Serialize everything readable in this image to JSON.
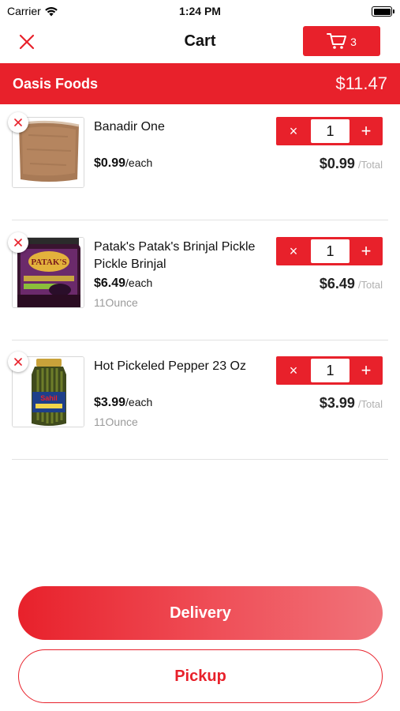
{
  "status_bar": {
    "carrier": "Carrier",
    "time": "1:24 PM",
    "icons": [
      "wifi-icon",
      "battery-icon"
    ]
  },
  "nav": {
    "title": "Cart",
    "close_icon": "close-icon",
    "cart_icon": "cart-icon",
    "cart_count": "3"
  },
  "store": {
    "name": "Oasis Foods",
    "total": "$11.47"
  },
  "items": [
    {
      "name": "Banadir One",
      "price": "$0.99",
      "price_unit": "/each",
      "size": "",
      "quantity": "1",
      "line_total": "$0.99",
      "line_total_label": "/Total"
    },
    {
      "name": "Patak's Patak's Brinjal Pickle Pickle Brinjal",
      "price": "$6.49",
      "price_unit": "/each",
      "size": "11Ounce",
      "quantity": "1",
      "line_total": "$6.49",
      "line_total_label": "/Total",
      "product_label_text": "PATAK'S"
    },
    {
      "name": "Hot Pickeled Pepper 23 Oz",
      "price": "$3.99",
      "price_unit": "/each",
      "size": "11Ounce",
      "quantity": "1",
      "line_total": "$3.99",
      "line_total_label": "/Total",
      "product_label_text": "Sahil"
    }
  ],
  "qty_controls": {
    "minus": "×",
    "plus": "+"
  },
  "actions": {
    "delivery": "Delivery",
    "pickup": "Pickup"
  },
  "colors": {
    "accent": "#e8212b",
    "divider": "#e2e2e2",
    "muted_text": "#9a9a9a"
  }
}
